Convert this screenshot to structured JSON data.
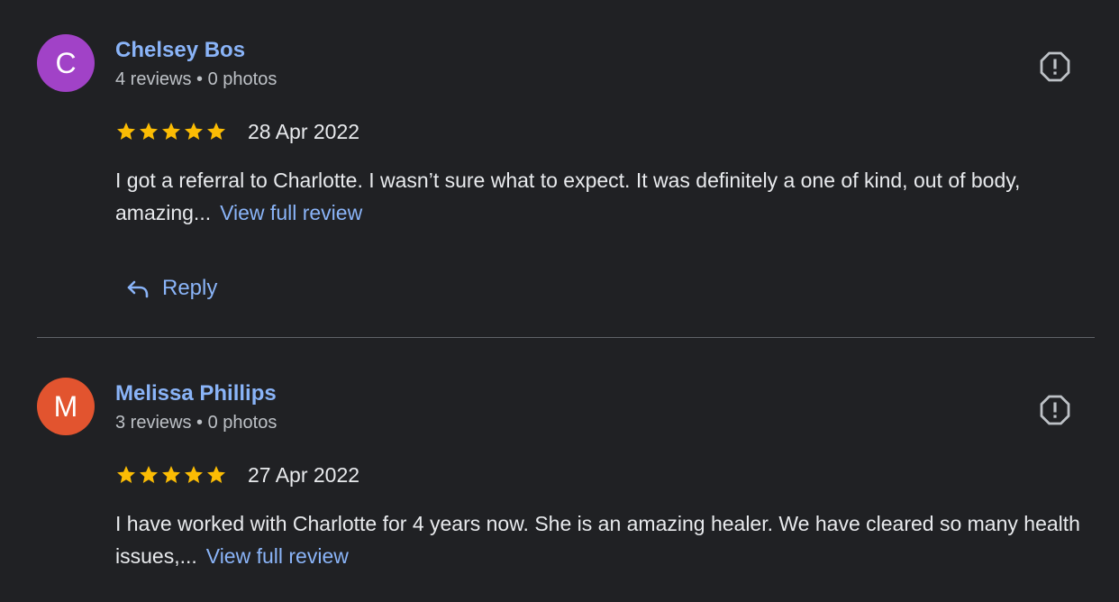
{
  "colors": {
    "background": "#202124",
    "link": "#8ab4f8",
    "star": "#fbbc04",
    "text": "#e8eaed",
    "secondary_text": "#bdc1c6"
  },
  "reviews": [
    {
      "avatar_letter": "C",
      "avatar_color": "#a142c7",
      "author": "Chelsey Bos",
      "stats": "4 reviews • 0 photos",
      "rating": 5,
      "date": "28 Apr 2022",
      "text": "I got a referral to Charlotte. I wasn’t sure what to expect. It was definitely a one of kind, out of body, amazing...",
      "more_label": "View full review",
      "reply_label": "Reply",
      "flag_icon": "report-icon"
    },
    {
      "avatar_letter": "M",
      "avatar_color": "#e2542f",
      "author": "Melissa Phillips",
      "stats": "3 reviews • 0 photos",
      "rating": 5,
      "date": "27 Apr 2022",
      "text": "I have worked with Charlotte for 4 years now. She is an amazing healer. We have cleared so many health issues,...",
      "more_label": "View full review",
      "flag_icon": "report-icon"
    }
  ]
}
